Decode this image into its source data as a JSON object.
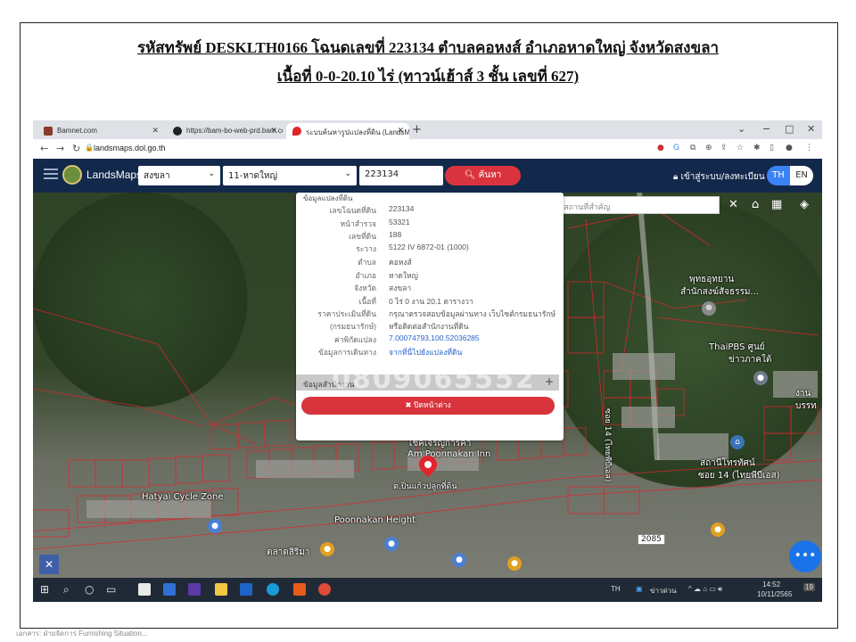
{
  "document": {
    "title_line1": "รหัสทรัพย์ DESKLTH0166 โฉนดเลขที่ 223134 ตำบลคอหงส์ อำเภอหาดใหญ่ จังหวัดสงขลา",
    "title_line2": "เนื้อที่ 0-0-20.10 ไร่ (ทาวน์เฮ้าส์ 3 ชั้น เลขที่ 627)",
    "footer": "เอกสาร: ฝ่ายจัดการ  Furnishing Situation..."
  },
  "browser": {
    "tabs": [
      {
        "label": "Bamnet.com",
        "active": false
      },
      {
        "label": "https://bam-bo-web-prd.bam.co",
        "active": false
      },
      {
        "label": "ระบบค้นหารูปแปลงที่ดิน (LandsMaps)",
        "active": true
      }
    ],
    "new_tab": "+",
    "window_controls": [
      "⌄",
      "−",
      "□",
      "✕"
    ],
    "url": "landsmaps.dol.go.th"
  },
  "app": {
    "brand": "LandsMaps",
    "province": "สงขลา",
    "district": "11-หาดใหญ่",
    "deed_number": "223134",
    "search_label": "ค้นหา",
    "login_label": "เข้าสู่ระบบ/ลงทะเบียน",
    "lang_th": "TH",
    "lang_en": "EN",
    "place_search_placeholder": "ค้นหาสถานที่สำคัญ",
    "accent": "#d9343d",
    "header_bg": "#13294b"
  },
  "popup": {
    "cut_heading": "ข้อมูลแปลงที่ดิน",
    "rows": [
      {
        "k": "เลขโฉนดที่ดิน",
        "v": "223134",
        "link": false
      },
      {
        "k": "หน้าสำรวจ",
        "v": "53321",
        "link": false
      },
      {
        "k": "เลขที่ดิน",
        "v": "188",
        "link": false
      },
      {
        "k": "ระวาง",
        "v": "5122 IV 6872-01 (1000)",
        "link": false
      },
      {
        "k": "ตำบล",
        "v": "คอหงส์",
        "link": false
      },
      {
        "k": "อำเภอ",
        "v": "หาดใหญ่",
        "link": false
      },
      {
        "k": "จังหวัด",
        "v": "สงขลา",
        "link": false
      },
      {
        "k": "เนื้อที่",
        "v": "0 ไร่ 0 งาน 20.1 ตารางวา",
        "link": false
      },
      {
        "k": "ราคาประเมินที่ดิน",
        "v": "กรุณาตรวจสอบข้อมูลผ่านทาง เว็บไซต์กรมธนารักษ์",
        "link": false
      },
      {
        "k": "(กรมธนารักษ์)",
        "v": "หรือติดต่อสำนักงานที่ดิน",
        "link": false
      },
      {
        "k": "ค่าพิกัดแปลง",
        "v": "7.00074793,100.52036285",
        "link": true
      },
      {
        "k": "ข้อมูลการเดินทาง",
        "v": "จากที่นี่ไปยังแปลงที่ดิน",
        "link": true
      }
    ],
    "gray_bar_label": "ข้อมูลสำนักงาน",
    "watermark": "0809065552",
    "close_label": "ปิดหน้าต่าง"
  },
  "map": {
    "labels": [
      {
        "name": "label-temple",
        "text": "พุทธอุทยาน"
      },
      {
        "name": "label-temple-2",
        "text": "สำนักสงฆ์สัจธรรม..."
      },
      {
        "name": "label-thaipbs",
        "text": "ThaiPBS ศูนย์"
      },
      {
        "name": "label-thaipbs-2",
        "text": "ข่าวภาคใต้"
      },
      {
        "name": "label-hatyai-cycle",
        "text": "Hatyai Cycle Zone"
      },
      {
        "name": "label-inn",
        "text": "Am Poonnakan Inn"
      },
      {
        "name": "label-inn-2",
        "text": "Poonnakan Height"
      },
      {
        "name": "label-shop",
        "text": "โชคเจริญการค้า"
      },
      {
        "name": "label-market",
        "text": "ตลาดสิริมา"
      },
      {
        "name": "label-school",
        "text": "ไทยพีบีเอส"
      },
      {
        "name": "label-school-2",
        "text": "สถานีโทรทัศน์"
      },
      {
        "name": "label-soi",
        "text": "ซอย 14 (ไทยพีบีเอส)"
      },
      {
        "name": "label-village",
        "text": "ต.ปิ่นแก้วปลูกที่ดิน"
      },
      {
        "name": "label-right",
        "text": "งาน"
      },
      {
        "name": "label-right-2",
        "text": "บรรท"
      }
    ],
    "road_number": "2085",
    "fab_icon": "•••"
  },
  "taskbar": {
    "lang": "TH",
    "weather": "ข่าวด่วน",
    "time": "14:52",
    "date": "10/11/2565",
    "notif_count": "19"
  }
}
